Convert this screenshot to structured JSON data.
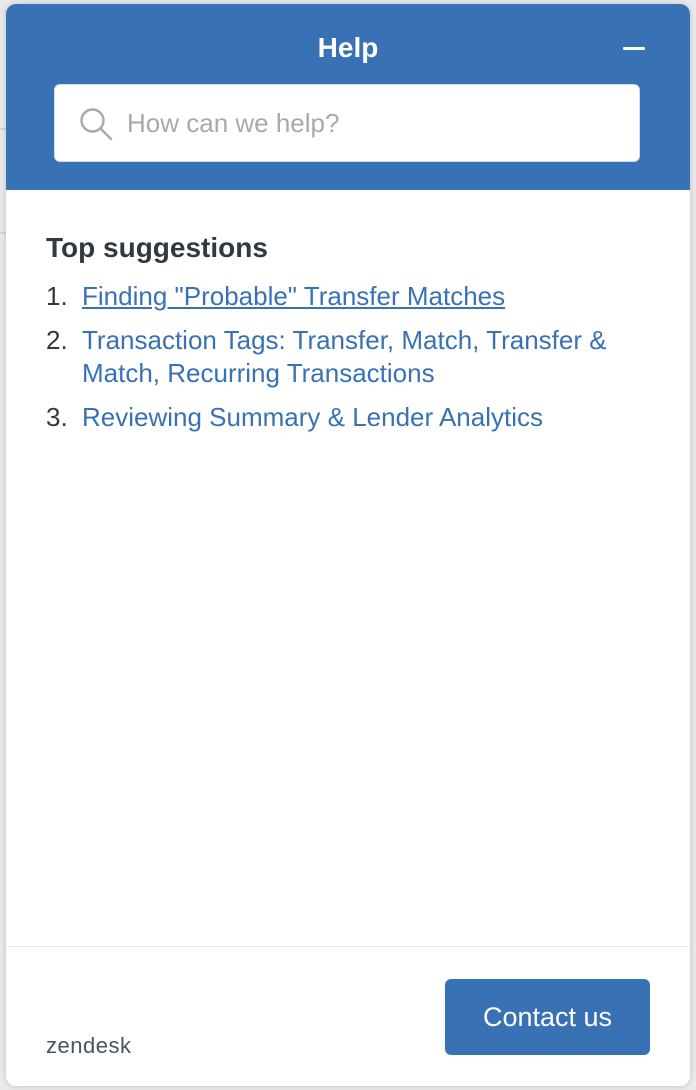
{
  "colors": {
    "accent": "#3872b4",
    "heading_text": "#2f3941",
    "placeholder_text": "#a6aab0",
    "brand_text": "#49545c"
  },
  "header": {
    "title": "Help",
    "minimize_icon": "minus-icon"
  },
  "search": {
    "icon": "search-icon",
    "value": "",
    "placeholder": "How can we help?"
  },
  "suggestions": {
    "heading": "Top suggestions",
    "items": [
      {
        "number": "1.",
        "label": "Finding \"Probable\" Transfer Matches"
      },
      {
        "number": "2.",
        "label": "Transaction Tags: Transfer, Match, Transfer & Match, Recurring Transactions"
      },
      {
        "number": "3.",
        "label": "Reviewing Summary & Lender Analytics"
      }
    ]
  },
  "footer": {
    "brand": "zendesk",
    "contact_label": "Contact us"
  }
}
